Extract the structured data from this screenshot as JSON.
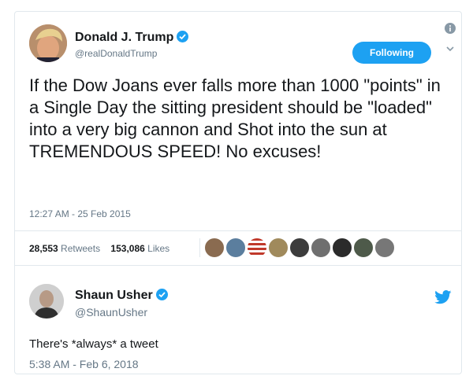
{
  "tweet1": {
    "name": "Donald J. Trump",
    "handle": "@realDonaldTrump",
    "follow_label": "Following",
    "text": "If the Dow Joans ever falls more than 1000 \"points\" in a Single Day the sitting president should be \"loaded\" into a very big cannon and Shot into the sun at TREMENDOUS SPEED! No excuses!",
    "timestamp": "12:27 AM - 25 Feb 2015",
    "retweets_count": "28,553",
    "retweets_label": "Retweets",
    "likes_count": "153,086",
    "likes_label": "Likes"
  },
  "tweet2": {
    "name": "Shaun Usher",
    "handle": "@ShaunUsher",
    "text": "There's *always* a tweet",
    "timestamp": "5:38 AM - Feb 6, 2018"
  },
  "icons": {
    "verified": "verified-badge-icon",
    "info": "info-icon",
    "menu": "chevron-down-icon",
    "brand": "twitter-bird-icon"
  },
  "colors": {
    "accent": "#1da1f2",
    "text": "#14171a",
    "muted": "#657786",
    "border": "#e1e8ed"
  }
}
